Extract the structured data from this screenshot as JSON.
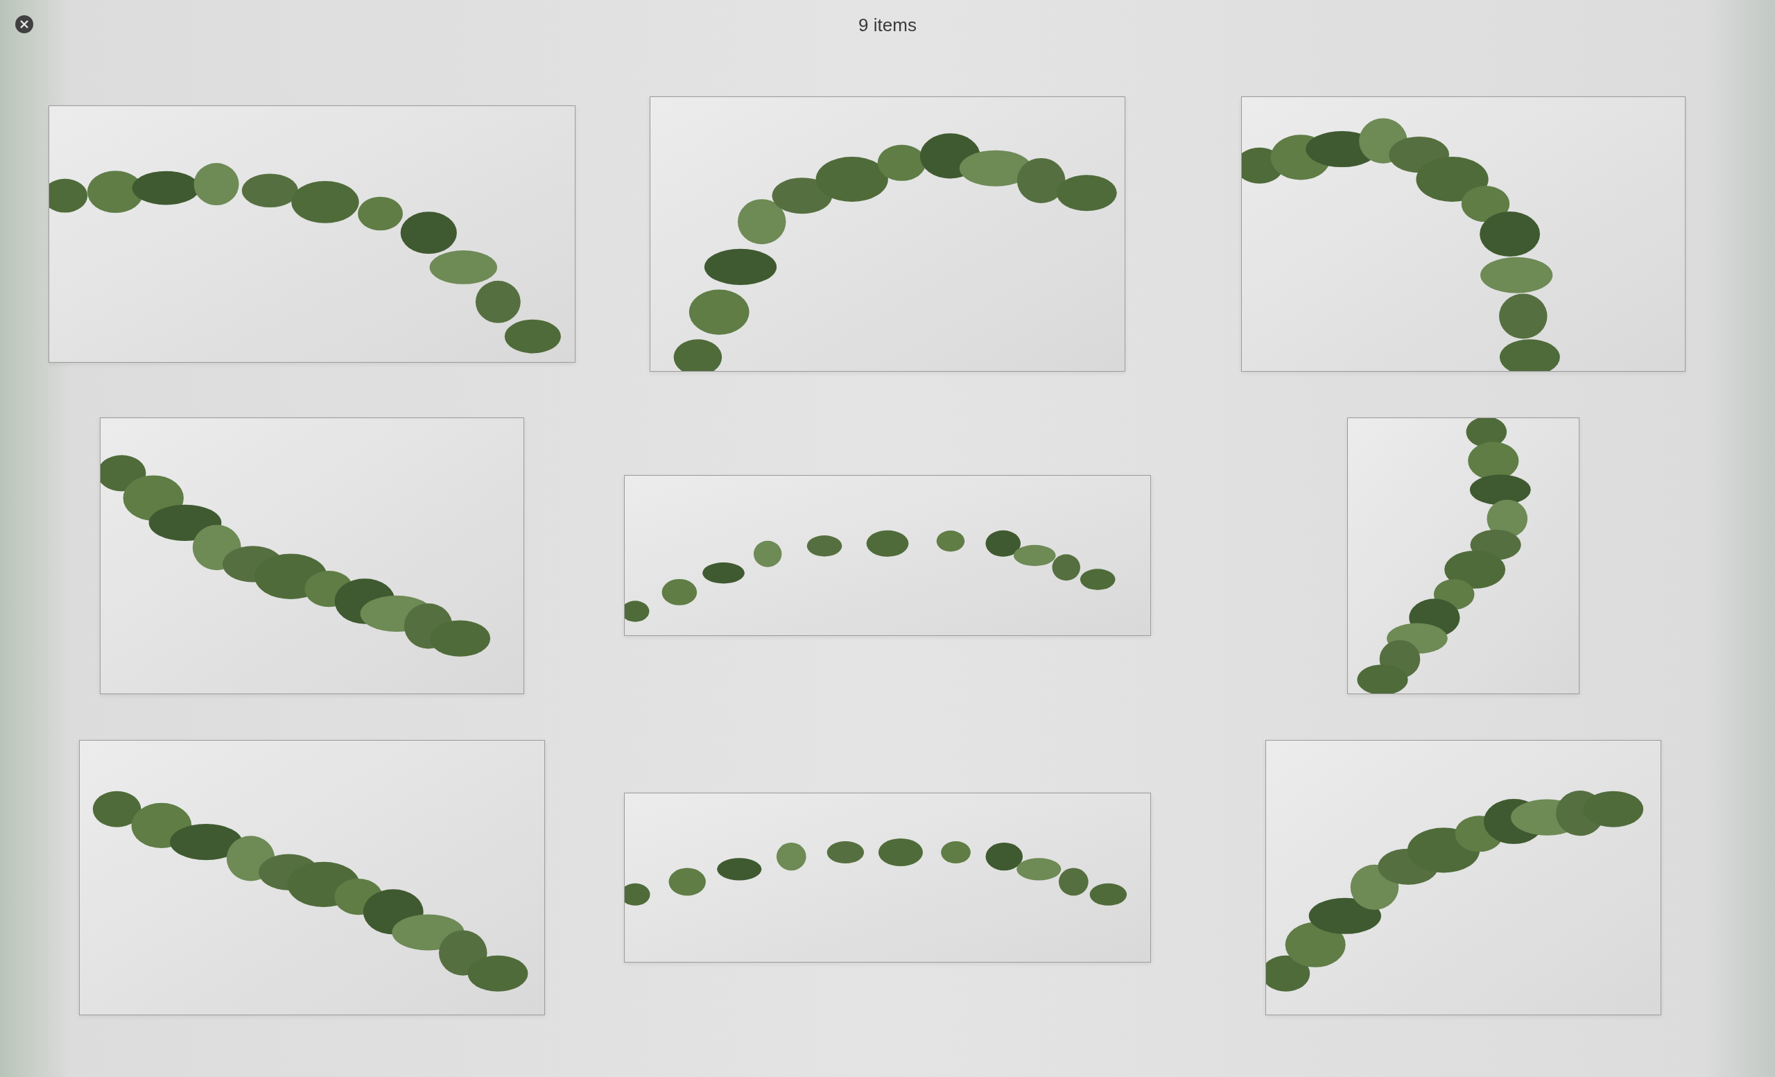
{
  "window": {
    "title": "9 items"
  }
}
